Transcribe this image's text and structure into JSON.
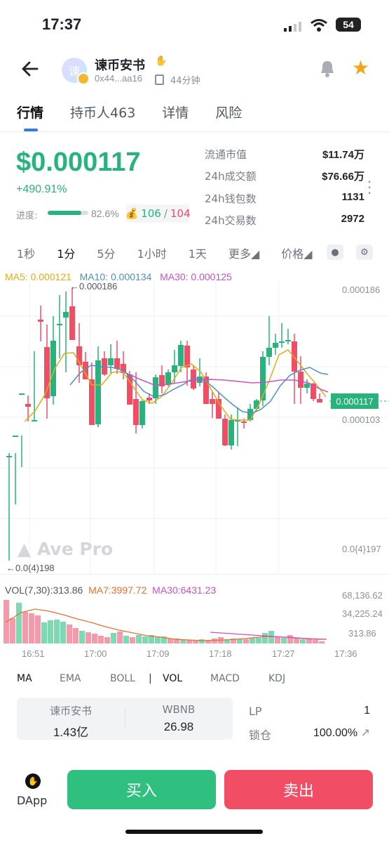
{
  "status": {
    "time": "17:37",
    "battery": "54"
  },
  "header": {
    "token_name": "谏币安书",
    "address": "0x44...aa16",
    "age": "44分钟",
    "avatar_char": "谏"
  },
  "tabs": [
    "行情",
    "持币人463",
    "详情",
    "风险"
  ],
  "price": {
    "value": "$0.000117",
    "change": "+490.91%",
    "progress_label": "进度:",
    "progress_percent": 82.6,
    "progress_text": "82.6%",
    "buy_count": "106",
    "separator": "/",
    "sell_count": "104"
  },
  "stats": [
    {
      "label": "流通市值",
      "value": "$11.74万"
    },
    {
      "label": "24h成交额",
      "value": "$76.66万"
    },
    {
      "label": "24h钱包数",
      "value": "1131"
    },
    {
      "label": "24h交易数",
      "value": "2972"
    }
  ],
  "intervals": [
    "1秒",
    "1分",
    "5分",
    "1小时",
    "1天",
    "更多",
    "价格"
  ],
  "ma": {
    "ma5": "MA5: 0.000121",
    "ma10": "MA10: 0.000134",
    "ma30": "MA30: 0.000125"
  },
  "chart_labels": {
    "high_marker": "←0.000186",
    "low_marker": "←0.0(4)198",
    "axis_top": "0.000186",
    "axis_mid": "0.000103",
    "axis_low": "0.0{4}197",
    "current_price": "0.000117",
    "watermark": "Ave Pro"
  },
  "vol": {
    "label": "VOL(7,30):313.86",
    "ma7": "MA7:3997.72",
    "ma30": "MA30:6431.23",
    "axis_top": "68,136.62",
    "axis_mid": "34,225.24",
    "axis_low": "313.86"
  },
  "time_axis": [
    "16:51",
    "17:00",
    "17:09",
    "17:18",
    "17:27",
    "17:36"
  ],
  "indicators": [
    "MA",
    "EMA",
    "BOLL",
    "|",
    "VOL",
    "MACD",
    "KDJ"
  ],
  "pool": {
    "token_label": "谏币安书",
    "token_value": "1.43亿",
    "pair_label": "WBNB",
    "pair_value": "26.98"
  },
  "lp": {
    "label": "LP",
    "value": "1",
    "lock_label": "锁仓",
    "lock_value": "100.00%"
  },
  "bottom": {
    "dapp": "DApp",
    "buy": "买入",
    "sell": "卖出"
  },
  "colors": {
    "green": "#28b37c",
    "red": "#f14d65",
    "ma5": "#e5aa16",
    "ma10": "#4d8fc8",
    "ma30": "#c653c3"
  },
  "chart_data": {
    "type": "candlestick",
    "price_axis_labels": [
      "0.000186",
      "0.000103",
      "0.0{4}197"
    ],
    "volume_axis_labels": [
      "68,136.62",
      "34,225.24",
      "313.86"
    ],
    "x_ticks": [
      "16:51",
      "17:00",
      "17:09",
      "17:18",
      "17:27",
      "17:36"
    ],
    "series": [
      {
        "name": "MA5: 0.000121"
      },
      {
        "name": "MA10: 0.000134"
      },
      {
        "name": "MA30: 0.000125"
      }
    ]
  }
}
